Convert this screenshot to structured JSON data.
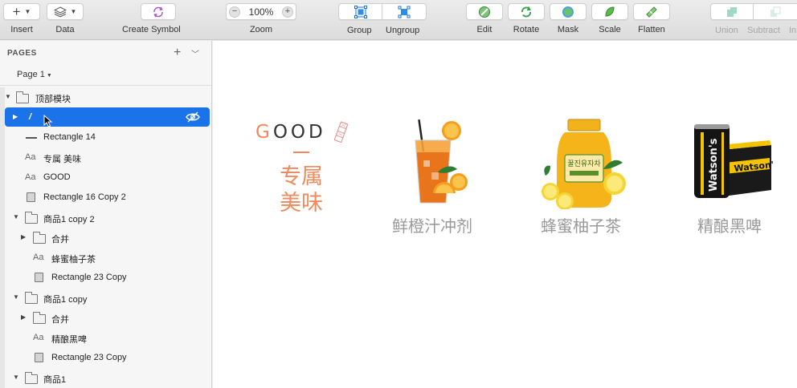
{
  "toolbar": {
    "insert": "Insert",
    "data": "Data",
    "create_symbol": "Create Symbol",
    "zoom": "Zoom",
    "zoom_value": "100%",
    "group": "Group",
    "ungroup": "Ungroup",
    "edit": "Edit",
    "rotate": "Rotate",
    "mask": "Mask",
    "scale": "Scale",
    "flatten": "Flatten",
    "union": "Union",
    "subtract": "Subtract",
    "intersect": "In"
  },
  "sidebar": {
    "pages_title": "PAGES",
    "page_selected": "Page 1",
    "layers": [
      {
        "label": "顶部模块",
        "type": "folder",
        "expanded": true
      },
      {
        "label": "/",
        "type": "slice",
        "selected": true
      },
      {
        "label": "Rectangle 14",
        "type": "line"
      },
      {
        "label": "专属 美味",
        "type": "text"
      },
      {
        "label": "GOOD",
        "type": "text"
      },
      {
        "label": "Rectangle 16 Copy 2",
        "type": "rect"
      },
      {
        "label": "商品1 copy 2",
        "type": "folder",
        "expanded": true
      },
      {
        "label": "合并",
        "type": "folder"
      },
      {
        "label": "蜂蜜柚子茶",
        "type": "text"
      },
      {
        "label": "Rectangle 23 Copy",
        "type": "rect"
      },
      {
        "label": "商品1 copy",
        "type": "folder",
        "expanded": true
      },
      {
        "label": "合并",
        "type": "folder"
      },
      {
        "label": "精酿黑啤",
        "type": "text"
      },
      {
        "label": "Rectangle 23 Copy",
        "type": "rect"
      },
      {
        "label": "商品1",
        "type": "folder",
        "expanded": true
      }
    ]
  },
  "canvas": {
    "good_first": "G",
    "good_rest": "OOD",
    "slogan_line1": "专属",
    "slogan_line2": "美味",
    "products": [
      {
        "name": "鲜橙汁冲剂"
      },
      {
        "name": "蜂蜜柚子茶"
      },
      {
        "name": "精酿黑啤"
      }
    ],
    "jar_label": "꿀진유자차",
    "can_label": "Watson's",
    "box_label": "Watson's"
  },
  "colors": {
    "accent": "#f08a5d",
    "selection": "#1a73e8",
    "product_text": "#9a9a9a"
  }
}
